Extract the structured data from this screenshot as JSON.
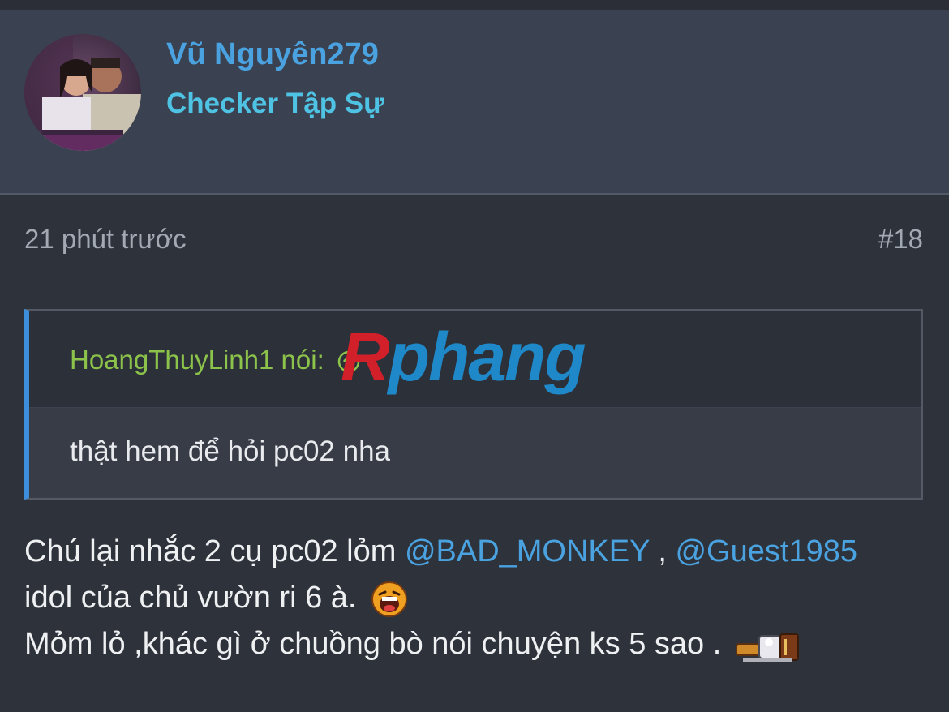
{
  "post": {
    "author": "Vũ Nguyên279",
    "rank": "Checker Tập Sự",
    "time": "21 phút trước",
    "post_number": "#18"
  },
  "quote": {
    "author": "HoangThuyLinh1",
    "said": "nói:",
    "text": "thật hem để hỏi pc02 nha"
  },
  "watermark": {
    "first": "R",
    "rest": "phang"
  },
  "body": {
    "line1_prefix": "Chú lại nhắc 2 cụ pc02 lỏm ",
    "mention1": "@BAD_MONKEY",
    "separator": " , ",
    "mention2": "@Guest1985",
    "line2": "idol của chủ vườn ri 6 à.",
    "line3": "Mỏm lỏ ,khác gì ở chuồng bò nói chuyện ks 5 sao ."
  },
  "colors": {
    "background": "#2e323b",
    "header_bg": "#3a4150",
    "username": "#4aa3e0",
    "rank": "#4fc3e3",
    "quote_author": "#8cc34a",
    "quote_bar": "#3d8fdb",
    "mention": "#4aa3e0"
  },
  "icons": {
    "quote_jump": "arrow-up-circle-icon",
    "emoji1": "laughing-face-emoji",
    "emoji2": "toaster-emoji"
  }
}
